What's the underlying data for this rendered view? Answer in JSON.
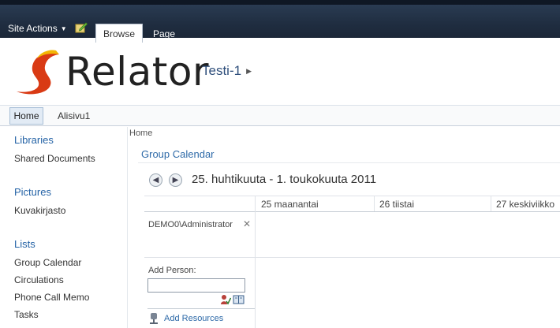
{
  "ribbon": {
    "site_actions": "Site Actions",
    "tabs": [
      {
        "label": "Browse",
        "selected": true
      },
      {
        "label": "Page",
        "selected": false
      }
    ]
  },
  "header": {
    "logo_text": "Relator",
    "site_title": "Testi-1"
  },
  "topnav": {
    "items": [
      {
        "label": "Home",
        "selected": true
      },
      {
        "label": "Alisivu1",
        "selected": false
      }
    ]
  },
  "quick_launch": {
    "libraries": {
      "heading": "Libraries",
      "items": [
        "Shared Documents"
      ]
    },
    "pictures": {
      "heading": "Pictures",
      "items": [
        "Kuvakirjasto"
      ]
    },
    "lists": {
      "heading": "Lists",
      "items": [
        "Group Calendar",
        "Circulations",
        "Phone Call Memo",
        "Tasks"
      ]
    }
  },
  "main": {
    "breadcrumb": "Home",
    "web_part_title": "Group Calendar",
    "date_range": "25. huhtikuuta - 1. toukokuuta 2011",
    "day_headers": [
      "25 maanantai",
      "26 tiistai",
      "27 keskiviikko"
    ],
    "person": "DEMO0\\Administrator",
    "add_person_label": "Add Person:",
    "add_person_value": "",
    "add_resources": "Add Resources"
  },
  "colors": {
    "ribbon_bg": "#1f2d40",
    "link_blue": "#2e6aa8",
    "logo_red": "#d93a14",
    "logo_yellow": "#f2b705"
  }
}
